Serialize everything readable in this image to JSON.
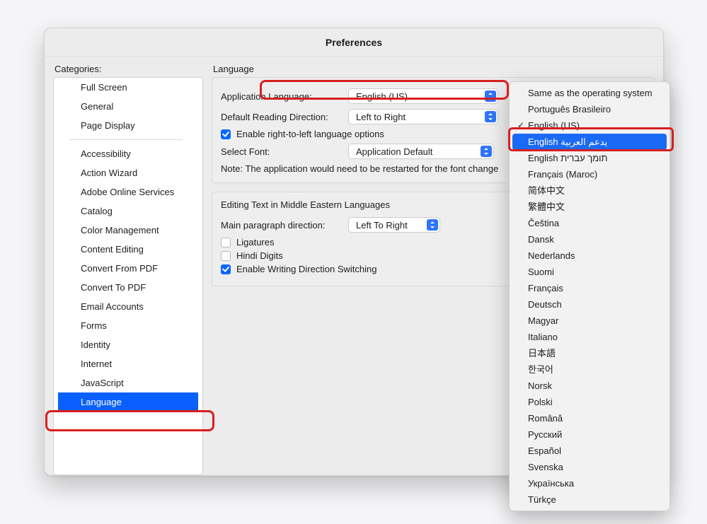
{
  "window": {
    "title": "Preferences"
  },
  "sidebar": {
    "label": "Categories:",
    "items": [
      {
        "label": "Full Screen",
        "selected": false,
        "sep_after": false
      },
      {
        "label": "General",
        "selected": false,
        "sep_after": false
      },
      {
        "label": "Page Display",
        "selected": false,
        "sep_after": true
      },
      {
        "label": "Accessibility",
        "selected": false,
        "sep_after": false
      },
      {
        "label": "Action Wizard",
        "selected": false,
        "sep_after": false
      },
      {
        "label": "Adobe Online Services",
        "selected": false,
        "sep_after": false
      },
      {
        "label": "Catalog",
        "selected": false,
        "sep_after": false
      },
      {
        "label": "Color Management",
        "selected": false,
        "sep_after": false
      },
      {
        "label": "Content Editing",
        "selected": false,
        "sep_after": false
      },
      {
        "label": "Convert From PDF",
        "selected": false,
        "sep_after": false
      },
      {
        "label": "Convert To PDF",
        "selected": false,
        "sep_after": false
      },
      {
        "label": "Email Accounts",
        "selected": false,
        "sep_after": false
      },
      {
        "label": "Forms",
        "selected": false,
        "sep_after": false
      },
      {
        "label": "Identity",
        "selected": false,
        "sep_after": false
      },
      {
        "label": "Internet",
        "selected": false,
        "sep_after": false
      },
      {
        "label": "JavaScript",
        "selected": false,
        "sep_after": false
      },
      {
        "label": "Language",
        "selected": true,
        "sep_after": false
      }
    ]
  },
  "panel": {
    "heading": "Language",
    "app_lang_label": "Application Language:",
    "app_lang_value": "English (US)",
    "reading_dir_label": "Default Reading Direction:",
    "reading_dir_value": "Left to Right",
    "rtl_checkbox": "Enable right-to-left language options",
    "rtl_checked": true,
    "font_label": "Select Font:",
    "font_value": "Application Default",
    "note": "Note: The application would need to be restarted for the font change",
    "editing_heading": "Editing Text in Middle Eastern Languages",
    "para_dir_label": "Main paragraph direction:",
    "para_dir_value": "Left To Right",
    "ligatures_label": "Ligatures",
    "ligatures_checked": false,
    "hindi_label": "Hindi Digits",
    "hindi_checked": false,
    "writing_switch_label": "Enable Writing Direction Switching",
    "writing_switch_checked": true
  },
  "menu": {
    "items": [
      {
        "label": "Same as the operating system"
      },
      {
        "label": "Português Brasileiro"
      },
      {
        "label": "English (US)",
        "checked": true
      },
      {
        "label": "English يدعم العربية",
        "selected": true
      },
      {
        "label": "English תומך עברית"
      },
      {
        "label": "Français (Maroc)"
      },
      {
        "label": "简体中文"
      },
      {
        "label": "繁體中文"
      },
      {
        "label": "Čeština"
      },
      {
        "label": "Dansk"
      },
      {
        "label": "Nederlands"
      },
      {
        "label": "Suomi"
      },
      {
        "label": "Français"
      },
      {
        "label": "Deutsch"
      },
      {
        "label": "Magyar"
      },
      {
        "label": "Italiano"
      },
      {
        "label": "日本語"
      },
      {
        "label": "한국어"
      },
      {
        "label": "Norsk"
      },
      {
        "label": "Polski"
      },
      {
        "label": "Română"
      },
      {
        "label": "Русский"
      },
      {
        "label": "Español"
      },
      {
        "label": "Svenska"
      },
      {
        "label": "Українська"
      },
      {
        "label": "Türkçe"
      }
    ]
  }
}
